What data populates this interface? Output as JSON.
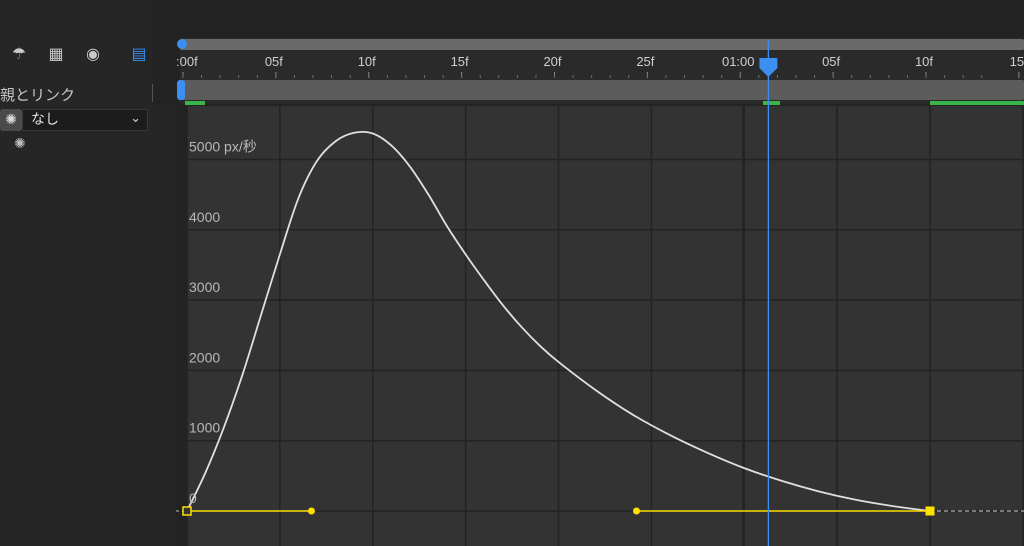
{
  "layer_panel": {
    "parent_link_label": "親とリンク",
    "parent_value": "なし",
    "icons": [
      "graph-tool-icon",
      "film-icon",
      "motion-blur-icon",
      "graph-editor-icon"
    ]
  },
  "timeline": {
    "time_labels": [
      ":00f",
      "05f",
      "10f",
      "15f",
      "20f",
      "25f",
      "01:00",
      "05f",
      "10f",
      "15"
    ],
    "playhead_color": "#3a8ff0",
    "keyframe_color": "#ffe000"
  },
  "chart_data": {
    "type": "line",
    "title": "",
    "xlabel": "",
    "ylabel": "",
    "unit_label": "px/秒",
    "x_unit": "frames",
    "x_range": [
      0,
      45
    ],
    "ylim": [
      0,
      5500
    ],
    "y_ticks": [
      {
        "value": 0,
        "label": "0"
      },
      {
        "value": 1000,
        "label": "1000"
      },
      {
        "value": 2000,
        "label": "2000"
      },
      {
        "value": 3000,
        "label": "3000"
      },
      {
        "value": 4000,
        "label": "4000"
      },
      {
        "value": 5000,
        "label": "5000 px/秒"
      }
    ],
    "grid": true,
    "series": [
      {
        "x": [
          0,
          1,
          2,
          3,
          4,
          5,
          6,
          7,
          8,
          9,
          10,
          11,
          12,
          13,
          14,
          15,
          16,
          17,
          18,
          19,
          20,
          22,
          24,
          26,
          28,
          30,
          32,
          34,
          36,
          38,
          40
        ],
        "values": [
          0,
          550,
          1200,
          1950,
          2800,
          3650,
          4450,
          4980,
          5260,
          5380,
          5370,
          5200,
          4900,
          4500,
          4050,
          3650,
          3280,
          2930,
          2620,
          2350,
          2120,
          1720,
          1370,
          1080,
          830,
          610,
          430,
          280,
          160,
          70,
          0
        ]
      }
    ],
    "keyframes": [
      {
        "frame": 0,
        "value": 0,
        "handle_out_frame": 6.7
      },
      {
        "frame": 40,
        "value": 0,
        "handle_in_frame": 24.2
      }
    ],
    "current_time_frame": 31.3
  }
}
